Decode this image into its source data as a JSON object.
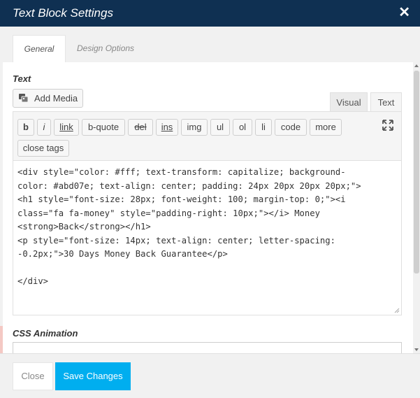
{
  "window": {
    "title": "Text Block Settings",
    "close_glyph": "✕"
  },
  "tabs": [
    {
      "label": "General",
      "active": true
    },
    {
      "label": "Design Options",
      "active": false
    }
  ],
  "text_section": {
    "label": "Text",
    "add_media_label": "Add Media",
    "editor_tabs": [
      "Visual",
      "Text"
    ],
    "quicktags": [
      "b",
      "i",
      "link",
      "b-quote",
      "del",
      "ins",
      "img",
      "ul",
      "ol",
      "li",
      "code",
      "more",
      "close tags"
    ],
    "content_lines": [
      "<div style=\"color: #fff; text-transform: capitalize; background-",
      "color: #abd07e; text-align: center; padding: 24px 20px 20px 20px;\">",
      "<h1 style=\"font-size: 28px; font-weight: 100; margin-top: 0;\"><i",
      "class=\"fa fa-money\" style=\"padding-right: 10px;\"></i> Money",
      "<strong>Back</strong></h1>",
      "<p style=\"font-size: 14px; text-align: center; letter-spacing:",
      "-0.2px;\">30 Days Money Back Guarantee</p>",
      "",
      "</div>"
    ]
  },
  "css_animation": {
    "label": "CSS Animation"
  },
  "footer": {
    "close_label": "Close",
    "save_label": "Save Changes"
  },
  "colors": {
    "titlebar": "#0f3052",
    "accent": "#00aeef"
  },
  "icons": [
    "close-icon",
    "media-icon",
    "fullscreen-icon",
    "resize-grip-icon"
  ]
}
